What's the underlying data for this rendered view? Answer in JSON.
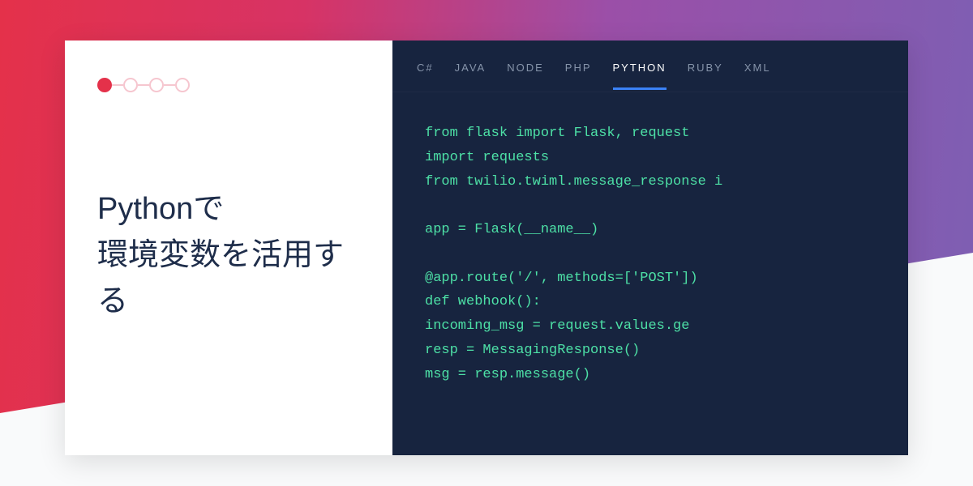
{
  "title_line1": "Pythonで",
  "title_line2": "環境変数を活用する",
  "tabs": {
    "t0": "C#",
    "t1": "JAVA",
    "t2": "NODE",
    "t3": "PHP",
    "t4": "PYTHON",
    "t5": "RUBY",
    "t6": "XML"
  },
  "active_tab": "PYTHON",
  "code": "from flask import Flask, request\nimport requests\nfrom twilio.twiml.message_response i\n\napp = Flask(__name__)\n\n@app.route('/', methods=['POST'])\ndef webhook():\nincoming_msg = request.values.ge\nresp = MessagingResponse()\nmsg = resp.message()"
}
